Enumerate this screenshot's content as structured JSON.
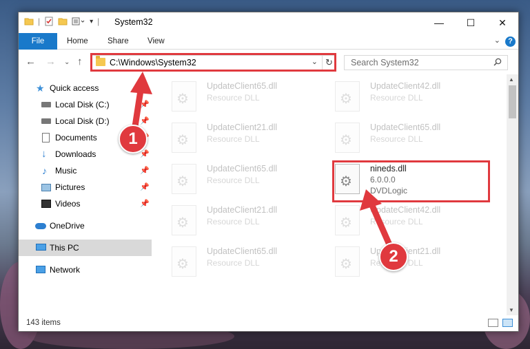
{
  "window": {
    "title": "System32",
    "controls": {
      "minimize": "—",
      "maximize": "☐",
      "close": "✕"
    }
  },
  "ribbon": {
    "tabs": [
      "File",
      "Home",
      "Share",
      "View"
    ],
    "help": "?"
  },
  "navigation": {
    "address": "C:\\Windows\\System32",
    "search_placeholder": "Search System32"
  },
  "sidebar": {
    "items": [
      {
        "label": "Quick access",
        "icon": "star-icon",
        "pinned": false
      },
      {
        "label": "Local Disk (C:)",
        "icon": "drive-icon",
        "pinned": true
      },
      {
        "label": "Local Disk (D:)",
        "icon": "drive-icon",
        "pinned": true
      },
      {
        "label": "Documents",
        "icon": "documents-icon",
        "pinned": true
      },
      {
        "label": "Downloads",
        "icon": "download-icon",
        "pinned": true
      },
      {
        "label": "Music",
        "icon": "music-icon",
        "pinned": true
      },
      {
        "label": "Pictures",
        "icon": "pictures-icon",
        "pinned": true
      },
      {
        "label": "Videos",
        "icon": "videos-icon",
        "pinned": true
      },
      {
        "label": "OneDrive",
        "icon": "cloud-icon",
        "pinned": false
      },
      {
        "label": "This PC",
        "icon": "computer-icon",
        "pinned": false
      },
      {
        "label": "Network",
        "icon": "network-icon",
        "pinned": false
      }
    ]
  },
  "files": [
    {
      "name": "UpdateClient65.dll",
      "type": "Resource DLL"
    },
    {
      "name": "UpdateClient42.dll",
      "type": "Resource DLL"
    },
    {
      "name": "UpdateClient21.dll",
      "type": "Resource DLL"
    },
    {
      "name": "UpdateClient65.dll",
      "type": "Resource DLL"
    },
    {
      "name": "UpdateClient65.dll",
      "type": "Resource DLL"
    },
    {
      "name": "nineds.dll",
      "version": "6.0.0.0",
      "company": "DVDLogic"
    },
    {
      "name": "UpdateClient21.dll",
      "type": "Resource DLL"
    },
    {
      "name": "UpdateClient42.dll",
      "type": "Resource DLL"
    },
    {
      "name": "UpdateClient65.dll",
      "type": "Resource DLL"
    },
    {
      "name": "UpdateClient21.dll",
      "type": "Resource DLL"
    }
  ],
  "status": {
    "item_count": "143 items"
  },
  "annotations": {
    "step1": "1",
    "step2": "2",
    "color": "#e0393e"
  }
}
